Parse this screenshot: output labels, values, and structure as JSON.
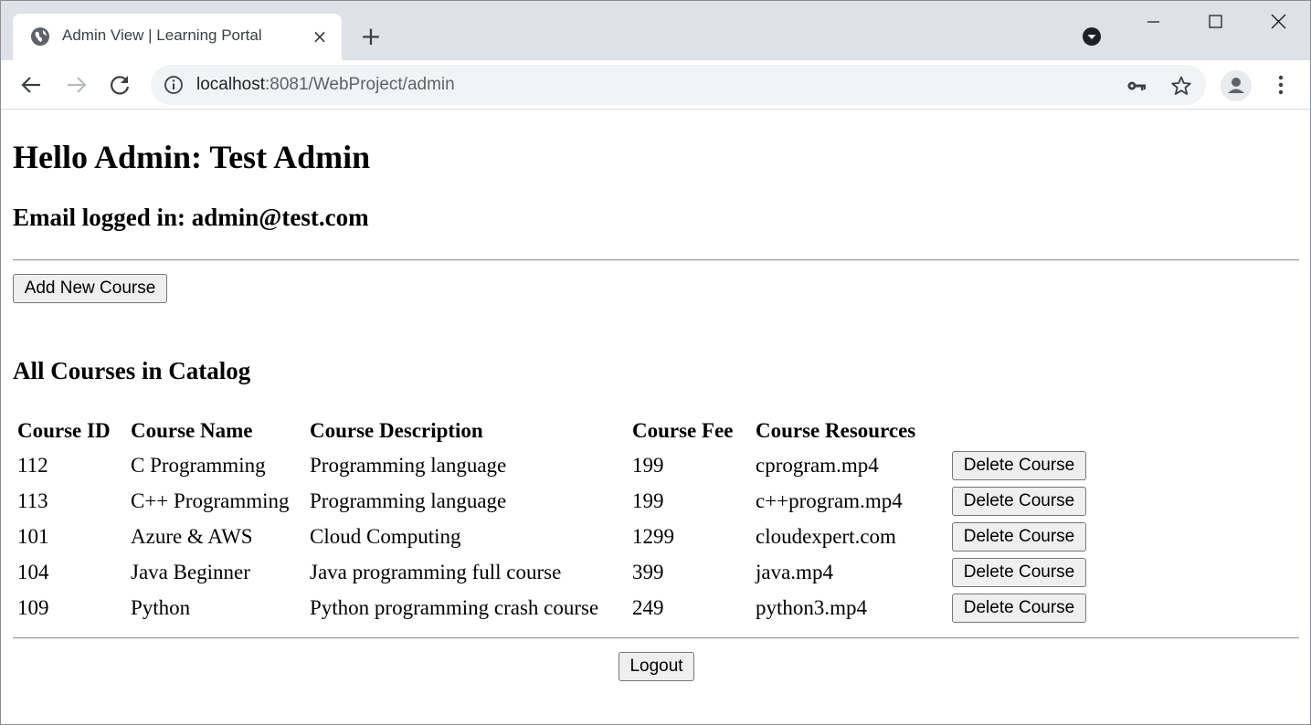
{
  "browser": {
    "tab_title": "Admin View | Learning Portal",
    "tab_close_glyph": "×",
    "new_tab_glyph": "+",
    "url_host": "localhost",
    "url_path": ":8081/WebProject/admin",
    "icons": [
      "globe-icon",
      "tab-search-icon",
      "minimize-icon",
      "maximize-icon",
      "close-window-icon",
      "back-icon",
      "forward-icon",
      "reload-icon",
      "info-icon",
      "key-icon",
      "star-icon",
      "profile-icon",
      "menu-icon"
    ]
  },
  "page": {
    "greeting": "Hello Admin: Test Admin",
    "email_line": "Email logged in: admin@test.com",
    "add_button": "Add New Course",
    "catalog_heading": "All Courses in Catalog",
    "logout_button": "Logout"
  },
  "table": {
    "headers": [
      "Course ID",
      "Course Name",
      "Course Description",
      "Course Fee",
      "Course Resources"
    ],
    "delete_label": "Delete Course",
    "rows": [
      {
        "id": "112",
        "name": "C Programming",
        "description": "Programming language",
        "fee": "199",
        "resource": "cprogram.mp4"
      },
      {
        "id": "113",
        "name": "C++ Programming",
        "description": "Programming language",
        "fee": "199",
        "resource": "c++program.mp4"
      },
      {
        "id": "101",
        "name": "Azure & AWS",
        "description": "Cloud Computing",
        "fee": "1299",
        "resource": "cloudexpert.com"
      },
      {
        "id": "104",
        "name": "Java Beginner",
        "description": "Java programming full course",
        "fee": "399",
        "resource": "java.mp4"
      },
      {
        "id": "109",
        "name": "Python",
        "description": "Python programming crash course",
        "fee": "249",
        "resource": "python3.mp4"
      }
    ]
  },
  "colors": {
    "tabstrip": "#dee1e6",
    "omnibox": "#f1f3f4",
    "button_face": "#efefef",
    "button_border": "#767676"
  }
}
